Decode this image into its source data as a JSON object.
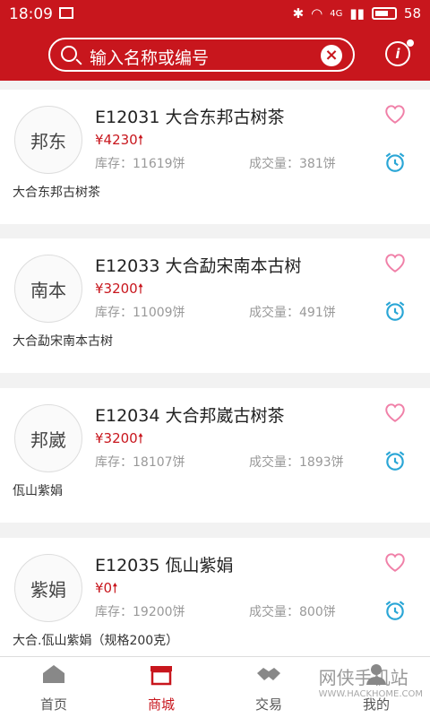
{
  "status_bar": {
    "time": "18:09",
    "network": "4G",
    "battery": "58"
  },
  "search": {
    "placeholder": "输入名称或编号"
  },
  "products": [
    {
      "code_name": "E12031 大合东邦古树茶",
      "price": "¥4230",
      "stock": "库存：11619饼",
      "volume": "成交量：381饼",
      "desc": "大合东邦古树茶",
      "logo_text": "邦东"
    },
    {
      "code_name": "E12033 大合勐宋南本古树",
      "price": "¥3200",
      "stock": "库存：11009饼",
      "volume": "成交量：491饼",
      "desc": "大合勐宋南本古树",
      "logo_text": "南本"
    },
    {
      "code_name": "E12034 大合邦崴古树茶",
      "price": "¥3200",
      "stock": "库存：18107饼",
      "volume": "成交量：1893饼",
      "desc": "佤山紫娟",
      "logo_text": "邦崴"
    },
    {
      "code_name": "E12035 佤山紫娟",
      "price": "¥0",
      "stock": "库存：19200饼",
      "volume": "成交量：800饼",
      "desc": "大合.佤山紫娟（规格200克）",
      "logo_text": "紫娟"
    }
  ],
  "nav": [
    {
      "label": "首页"
    },
    {
      "label": "商城"
    },
    {
      "label": "交易"
    },
    {
      "label": "我的"
    }
  ],
  "watermark": {
    "text": "网侠手机站",
    "sub": "WWW.HACKHOME.COM"
  },
  "colors": {
    "brand": "#c8161d",
    "heart": "#f080a8",
    "alarm": "#2aa6d6"
  }
}
